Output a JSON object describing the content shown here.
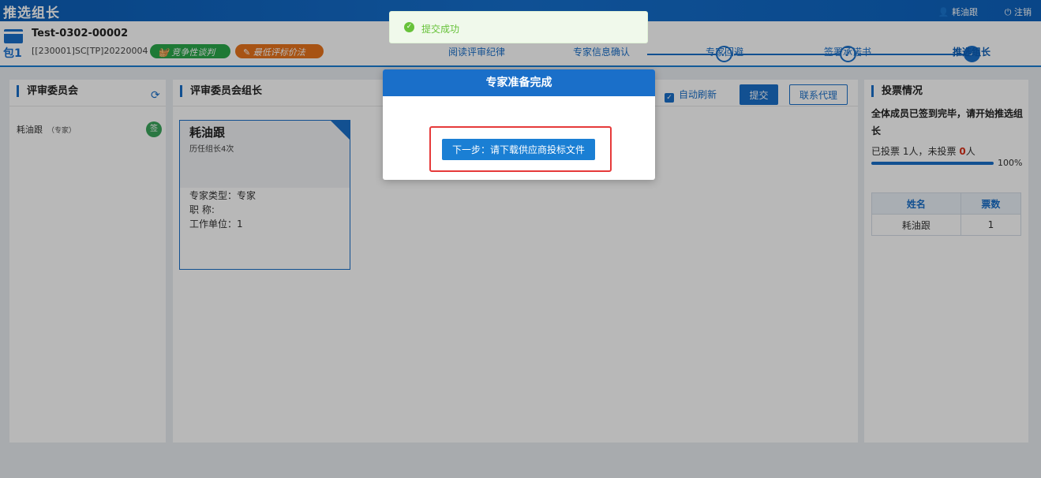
{
  "topbar": {
    "title": "推选组长",
    "user": "耗油跟",
    "logout": "注销"
  },
  "header": {
    "project_code": "Test-0302-00002",
    "project_sub": "[[230001]SC[TP]20220004 ]",
    "package_label": "包1",
    "tags": [
      "竞争性谈判",
      "最低评标价法"
    ],
    "steps": [
      "阅读评审纪律",
      "专家信息确认",
      "专家回避",
      "签署承诺书",
      "推选组长"
    ]
  },
  "left_panel": {
    "title": "评审委员会",
    "member": "耗油跟",
    "member_role": "（专家）",
    "signed_badge": "签"
  },
  "mid_panel": {
    "title": "评审委员会组长",
    "auto_refresh": "自动刷新",
    "submit": "提交",
    "contact": "联系代理",
    "card": {
      "name": "耗油跟",
      "history": "历任组长4次",
      "type": "专家类型：专家",
      "title_line": "职 称:",
      "unit": "工作单位：1"
    }
  },
  "right_panel": {
    "title": "投票情况",
    "status": "全体成员已签到完毕，请开始推选组长",
    "voted_prefix": "已投票",
    "voted_count": "1",
    "voted_mid": "人，未投票",
    "unvoted_count": "0",
    "voted_suffix": "人",
    "progress_percent": 100,
    "progress_label": "100%",
    "table": {
      "headers": [
        "姓名",
        "票数"
      ],
      "rows": [
        [
          "耗油跟",
          "1"
        ]
      ]
    }
  },
  "toast": {
    "message": "提交成功"
  },
  "modal": {
    "title": "专家准备完成",
    "button": "下一步：请下载供应商投标文件"
  },
  "colors": {
    "primary": "#1a6fc9",
    "highlight": "#e63a3a",
    "success": "#67c23a"
  }
}
